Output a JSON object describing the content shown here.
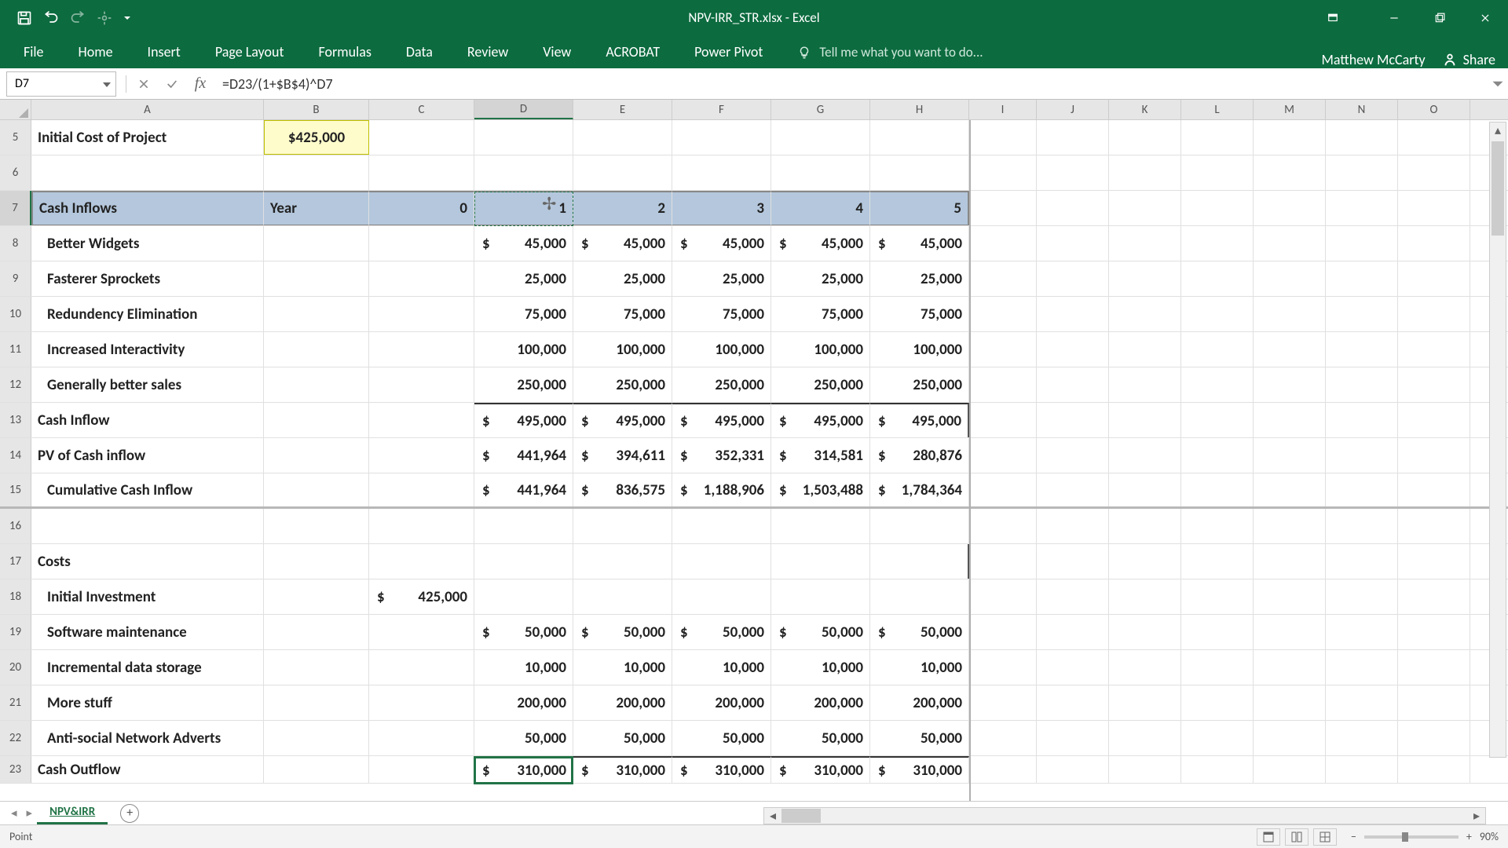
{
  "app": {
    "title": "NPV-IRR_STR.xlsx - Excel"
  },
  "ribbon": {
    "tabs": [
      "File",
      "Home",
      "Insert",
      "Page Layout",
      "Formulas",
      "Data",
      "Review",
      "View",
      "ACROBAT",
      "Power Pivot"
    ],
    "tellme": "Tell me what you want to do...",
    "user": "Matthew McCarty",
    "share": "Share"
  },
  "formula": {
    "nameBox": "D7",
    "formula": "=D23/(1+$B$4)^D7"
  },
  "columns": [
    "A",
    "B",
    "C",
    "D",
    "E",
    "F",
    "G",
    "H",
    "I",
    "J",
    "K",
    "L",
    "M",
    "N",
    "O"
  ],
  "colSel": "D",
  "rows": {
    "r5": {
      "num": "5",
      "A": "Initial Cost of Project",
      "B": "$425,000"
    },
    "r6": {
      "num": "6"
    },
    "r7": {
      "num": "7",
      "A": "Cash Inflows",
      "B": "Year",
      "C": "0",
      "D": "1",
      "E": "2",
      "F": "3",
      "G": "4",
      "H": "5"
    },
    "r8": {
      "num": "8",
      "A": "Better Widgets",
      "D": "45,000",
      "E": "45,000",
      "F": "45,000",
      "G": "45,000",
      "H": "45,000"
    },
    "r9": {
      "num": "9",
      "A": "Fasterer Sprockets",
      "D": "25,000",
      "E": "25,000",
      "F": "25,000",
      "G": "25,000",
      "H": "25,000"
    },
    "r10": {
      "num": "10",
      "A": "Redundency Elimination",
      "D": "75,000",
      "E": "75,000",
      "F": "75,000",
      "G": "75,000",
      "H": "75,000"
    },
    "r11": {
      "num": "11",
      "A": "Increased Interactivity",
      "D": "100,000",
      "E": "100,000",
      "F": "100,000",
      "G": "100,000",
      "H": "100,000"
    },
    "r12": {
      "num": "12",
      "A": "Generally better sales",
      "D": "250,000",
      "E": "250,000",
      "F": "250,000",
      "G": "250,000",
      "H": "250,000"
    },
    "r13": {
      "num": "13",
      "A": "Cash Inflow",
      "D": "495,000",
      "E": "495,000",
      "F": "495,000",
      "G": "495,000",
      "H": "495,000"
    },
    "r14": {
      "num": "14",
      "A": "PV of Cash inflow",
      "D": "441,964",
      "E": "394,611",
      "F": "352,331",
      "G": "314,581",
      "H": "280,876"
    },
    "r15": {
      "num": "15",
      "A": "Cumulative Cash Inflow",
      "D": "441,964",
      "E": "836,575",
      "F": "1,188,906",
      "G": "1,503,488",
      "H": "1,784,364"
    },
    "r16": {
      "num": "16"
    },
    "r17": {
      "num": "17",
      "A": "Costs"
    },
    "r18": {
      "num": "18",
      "A": "Initial Investment",
      "C": "425,000"
    },
    "r19": {
      "num": "19",
      "A": "Software maintenance",
      "D": "50,000",
      "E": "50,000",
      "F": "50,000",
      "G": "50,000",
      "H": "50,000"
    },
    "r20": {
      "num": "20",
      "A": "Incremental data storage",
      "D": "10,000",
      "E": "10,000",
      "F": "10,000",
      "G": "10,000",
      "H": "10,000"
    },
    "r21": {
      "num": "21",
      "A": "More stuff",
      "D": "200,000",
      "E": "200,000",
      "F": "200,000",
      "G": "200,000",
      "H": "200,000"
    },
    "r22": {
      "num": "22",
      "A": "Anti-social Network Adverts",
      "D": "50,000",
      "E": "50,000",
      "F": "50,000",
      "G": "50,000",
      "H": "50,000"
    },
    "r23": {
      "num": "23",
      "A": "Cash Outflow",
      "D": "310,000",
      "E": "310,000",
      "F": "310,000",
      "G": "310,000",
      "H": "310,000"
    }
  },
  "dollar": "$",
  "sheet": {
    "active": "NPV&IRR"
  },
  "status": {
    "mode": "Point",
    "zoom": "90%"
  }
}
